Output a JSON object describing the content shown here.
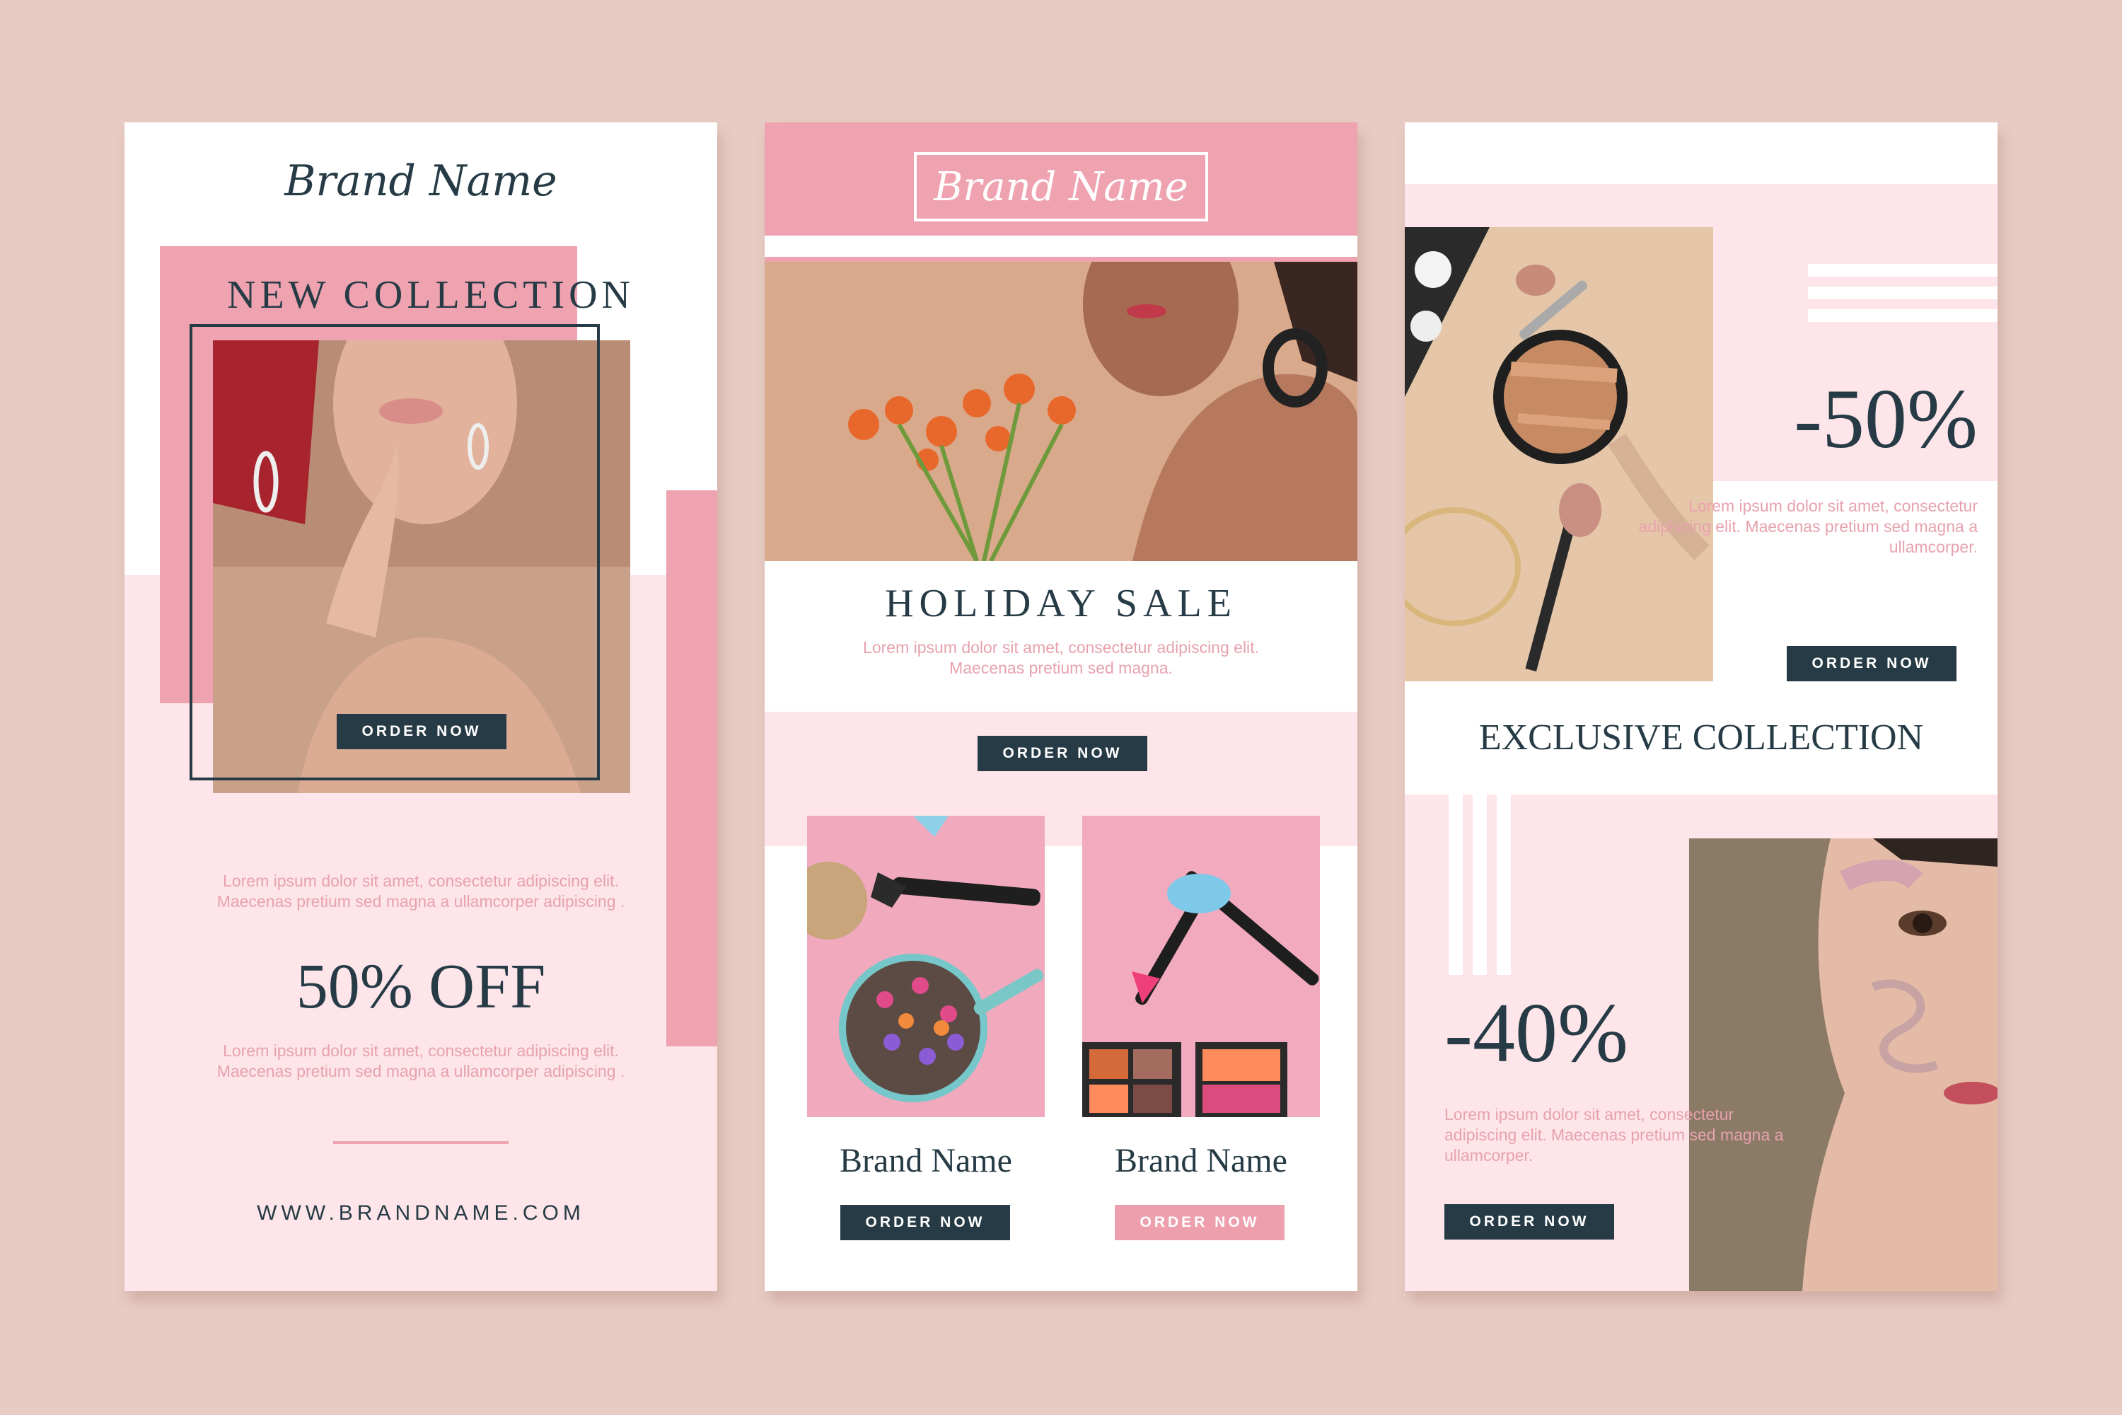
{
  "colors": {
    "background": "#e8ccc4",
    "pink": "#efa3b0",
    "light_pink": "#fde5e9",
    "dark": "#263b45",
    "text_pink": "#e7a2ae"
  },
  "card1": {
    "brand": "Brand Name",
    "headline": "NEW COLLECTION",
    "order_button": "ORDER NOW",
    "lorem_1": "Lorem ipsum dolor sit amet, consectetur adipiscing elit. Maecenas pretium sed magna a ullamcorper adipiscing .",
    "discount": "50% OFF",
    "lorem_2": "Lorem ipsum dolor sit amet, consectetur adipiscing elit. Maecenas pretium sed magna a ullamcorper adipiscing .",
    "website": "WWW.BRANDNAME.COM"
  },
  "card2": {
    "brand": "Brand Name",
    "headline": "HOLIDAY SALE",
    "lorem": "Lorem ipsum dolor sit amet, consectetur adipiscing elit. Maecenas pretium sed magna.",
    "order_button": "ORDER NOW",
    "products": [
      {
        "name": "Brand Name",
        "button": "ORDER NOW"
      },
      {
        "name": "Brand Name",
        "button": "ORDER NOW"
      }
    ]
  },
  "card3": {
    "discount_1": "-50%",
    "lorem_1": "Lorem ipsum dolor sit amet, consectetur adipiscing elit. Maecenas pretium sed magna a ullamcorper.",
    "order_button_1": "ORDER NOW",
    "headline": "EXCLUSIVE COLLECTION",
    "discount_2": "-40%",
    "lorem_2": "Lorem ipsum dolor sit amet, consectetur adipiscing elit. Maecenas pretium sed magna a ullamcorper.",
    "order_button_2": "ORDER NOW"
  },
  "icons": {
    "photos": [
      "model-photo",
      "model-flowers-photo",
      "makeup-brushes-photo",
      "eyeshadow-palette-photo",
      "powder-compact-photo",
      "model-face-paint-photo"
    ]
  }
}
